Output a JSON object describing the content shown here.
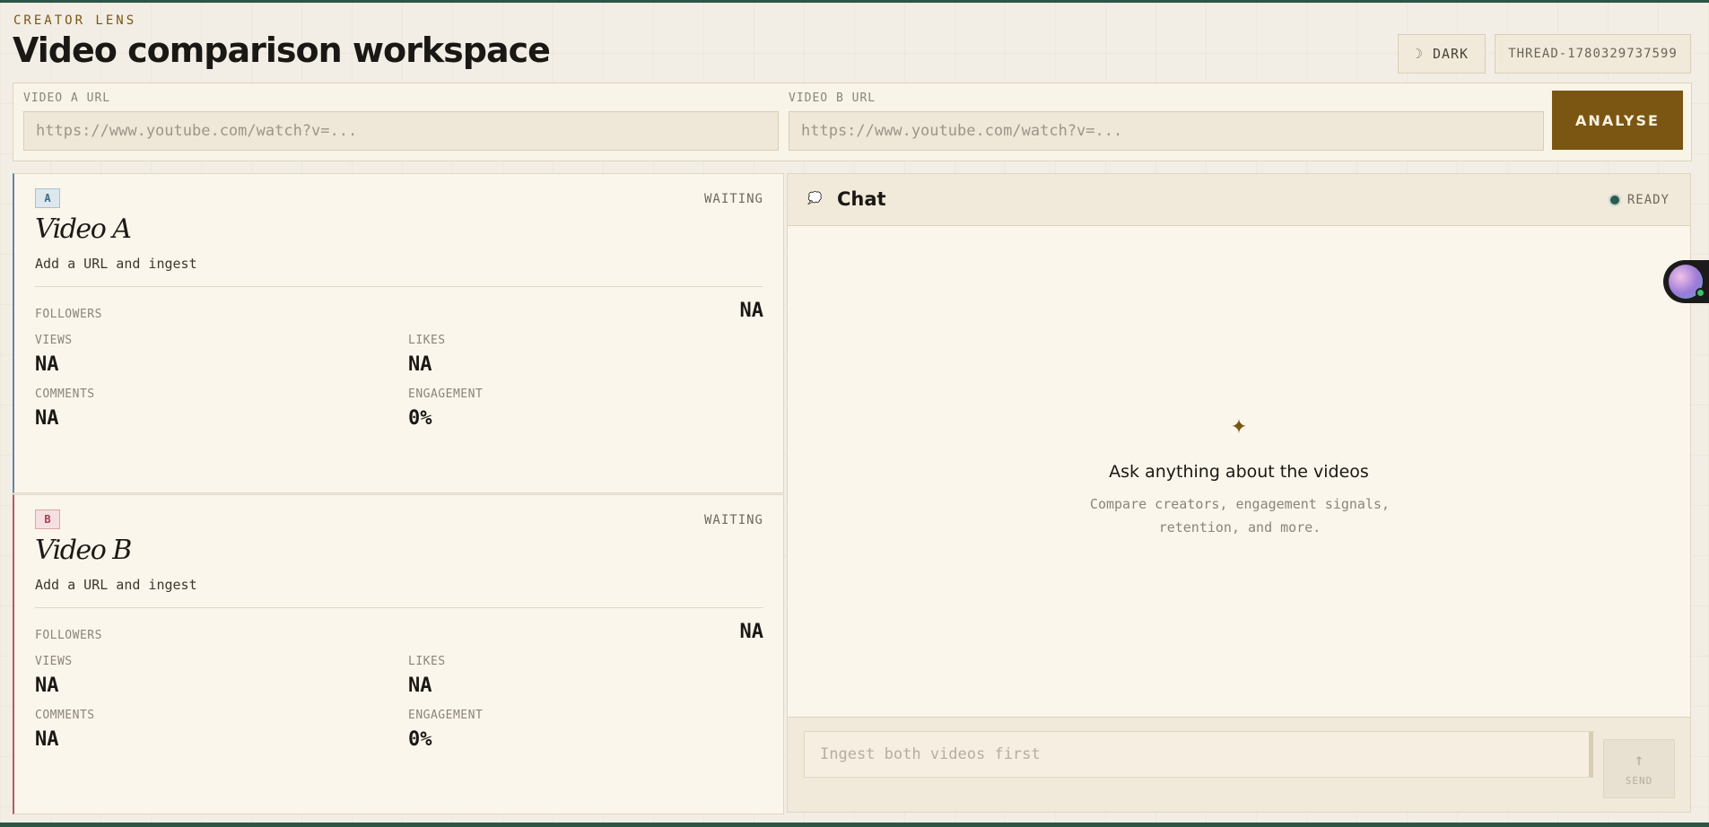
{
  "header": {
    "brand": "CREATOR LENS",
    "title": "Video comparison workspace",
    "dark_label": "DARK",
    "thread_id": "THREAD-1780329737599"
  },
  "inputs": {
    "video_a_label": "VIDEO A URL",
    "video_a_placeholder": "https://www.youtube.com/watch?v=...",
    "video_b_label": "VIDEO B URL",
    "video_b_placeholder": "https://www.youtube.com/watch?v=...",
    "analyse_label": "ANALYSE"
  },
  "videos": [
    {
      "badge": "A",
      "status": "WAITING",
      "title": "Video A",
      "subtitle": "Add a URL and ingest",
      "followers_label": "FOLLOWERS",
      "followers": "NA",
      "views_label": "VIEWS",
      "views": "NA",
      "likes_label": "LIKES",
      "likes": "NA",
      "comments_label": "COMMENTS",
      "comments": "NA",
      "engagement_label": "ENGAGEMENT",
      "engagement": "0%"
    },
    {
      "badge": "B",
      "status": "WAITING",
      "title": "Video B",
      "subtitle": "Add a URL and ingest",
      "followers_label": "FOLLOWERS",
      "followers": "NA",
      "views_label": "VIEWS",
      "views": "NA",
      "likes_label": "LIKES",
      "likes": "NA",
      "comments_label": "COMMENTS",
      "comments": "NA",
      "engagement_label": "ENGAGEMENT",
      "engagement": "0%"
    }
  ],
  "chat": {
    "title": "Chat",
    "status": "READY",
    "empty_title": "Ask anything about the videos",
    "empty_subtitle": "Compare creators, engagement signals, retention, and more.",
    "input_placeholder": "Ingest both videos first",
    "send_label": "SEND"
  },
  "colors": {
    "accent": "#7b5512",
    "video_a": "#5d87aa",
    "video_b": "#b2596a",
    "ready": "#2b5b50"
  },
  "icons": {
    "dark_toggle": "moon-icon",
    "chat": "chat-bubble-icon",
    "empty_state": "sparkle-icon",
    "send": "arrow-up-icon"
  }
}
